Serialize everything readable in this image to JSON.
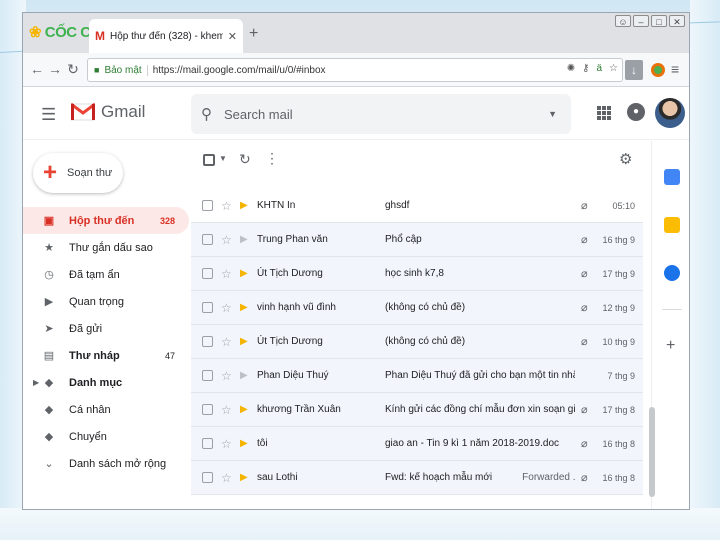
{
  "browser": {
    "brand": "CỐC CỐC",
    "tab_title": "Hộp thư đến (328) - khem",
    "new_tab": "+",
    "address": {
      "secure_label": "Bảo mật",
      "url": "https://mail.google.com/mail/u/0/#inbox"
    },
    "icons": [
      "back-icon",
      "forward-icon",
      "reload-icon",
      "lock-icon",
      "download-icon",
      "menu-icon"
    ]
  },
  "gmail": {
    "logo_text": "Gmail",
    "search_placeholder": "Search mail",
    "compose_label": "Soạn thư",
    "nav": [
      {
        "label": "Hộp thư đến",
        "count": "328",
        "icon": "inbox-icon",
        "active": true
      },
      {
        "label": "Thư gắn dấu sao",
        "count": "",
        "icon": "star-icon",
        "active": false
      },
      {
        "label": "Đã tạm ẩn",
        "count": "",
        "icon": "clock-icon",
        "active": false
      },
      {
        "label": "Quan trọng",
        "count": "",
        "icon": "important-icon",
        "active": false
      },
      {
        "label": "Đã gửi",
        "count": "",
        "icon": "send-icon",
        "active": false
      },
      {
        "label": "Thư nháp",
        "count": "47",
        "icon": "draft-icon",
        "active": false
      },
      {
        "label": "Danh mục",
        "count": "",
        "icon": "label-icon",
        "active": false
      },
      {
        "label": "Cá nhân",
        "count": "",
        "icon": "label-icon",
        "active": false
      },
      {
        "label": "Chuyển",
        "count": "",
        "icon": "label-icon",
        "active": false
      },
      {
        "label": "Danh sách mở rộng",
        "count": "",
        "icon": "chevron-down-icon",
        "active": false
      }
    ],
    "emails": [
      {
        "sender": "KHTN In",
        "subject": "ghsdf",
        "extra": "",
        "attachment": true,
        "important": true,
        "date": "05:10"
      },
      {
        "sender": "Trung Phan văn",
        "subject": "Phổ cập",
        "extra": "",
        "attachment": true,
        "important": false,
        "date": "16 thg 9"
      },
      {
        "sender": "Út Tịch Dương",
        "subject": "học sinh k7,8",
        "extra": "",
        "attachment": true,
        "important": true,
        "date": "17 thg 9"
      },
      {
        "sender": "vinh hạnh vũ đình",
        "subject": "(không có chủ đề)",
        "extra": "",
        "attachment": true,
        "important": true,
        "date": "12 thg 9"
      },
      {
        "sender": "Út Tịch Dương",
        "subject": "(không có chủ đề)",
        "extra": "",
        "attachment": true,
        "important": true,
        "date": "10 thg 9"
      },
      {
        "sender": "Phan Diệu Thuý",
        "subject": "Phan Diệu Thuý đã gửi cho bạn một tin nhắn. -",
        "extra": "",
        "attachment": false,
        "important": false,
        "date": "7 thg 9"
      },
      {
        "sender": "khương Trần Xuân",
        "subject": "Kính gửi các đồng chí mẫu đơn xin soạn giả...",
        "extra": "",
        "attachment": true,
        "important": true,
        "date": "17 thg 8"
      },
      {
        "sender": "tôi",
        "subject": "giao an - Tin 9 kì 1 năm 2018-2019.doc",
        "extra": "",
        "attachment": true,
        "important": true,
        "date": "16 thg 8"
      },
      {
        "sender": "sau Lothi",
        "subject": "Fwd: kế hoạch mẫu mới",
        "extra": "Forwarded ...",
        "attachment": true,
        "important": true,
        "date": "16 thg 8"
      }
    ]
  },
  "colors": {
    "accent_red": "#d93025",
    "important_yellow": "#f4b400",
    "active_bg": "#fce8e6"
  }
}
